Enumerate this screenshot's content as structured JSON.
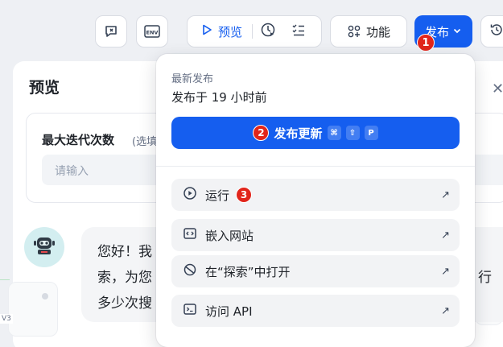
{
  "topbar": {
    "preview_label": "预览",
    "features_label": "功能",
    "publish_label": "发布",
    "env_icon_text": "ENV"
  },
  "badges": [
    "1",
    "2",
    "3"
  ],
  "panel": {
    "title": "预览",
    "close_icon": "close-icon",
    "field_label": "最大迭代次数",
    "field_hint": "(选填",
    "input_placeholder": "请输入",
    "message_lines": [
      "您好！我",
      "索，为您",
      "多少次搜"
    ],
    "message_tail": "行",
    "node_tag": "V3"
  },
  "dropdown": {
    "latest_label": "最新发布",
    "published_time": "发布于 19 小时前",
    "update_label": "发布更新",
    "shortcut": [
      "⌘",
      "⇧",
      "P"
    ],
    "items": [
      {
        "label": "运行",
        "icon": "play-icon"
      },
      {
        "label": "嵌入网站",
        "icon": "embed-icon"
      },
      {
        "label": "在“探索”中打开",
        "icon": "explore-icon"
      },
      {
        "label": "访问 API",
        "icon": "terminal-icon"
      }
    ]
  },
  "colors": {
    "accent": "#155eef",
    "badge": "#e1251b"
  }
}
